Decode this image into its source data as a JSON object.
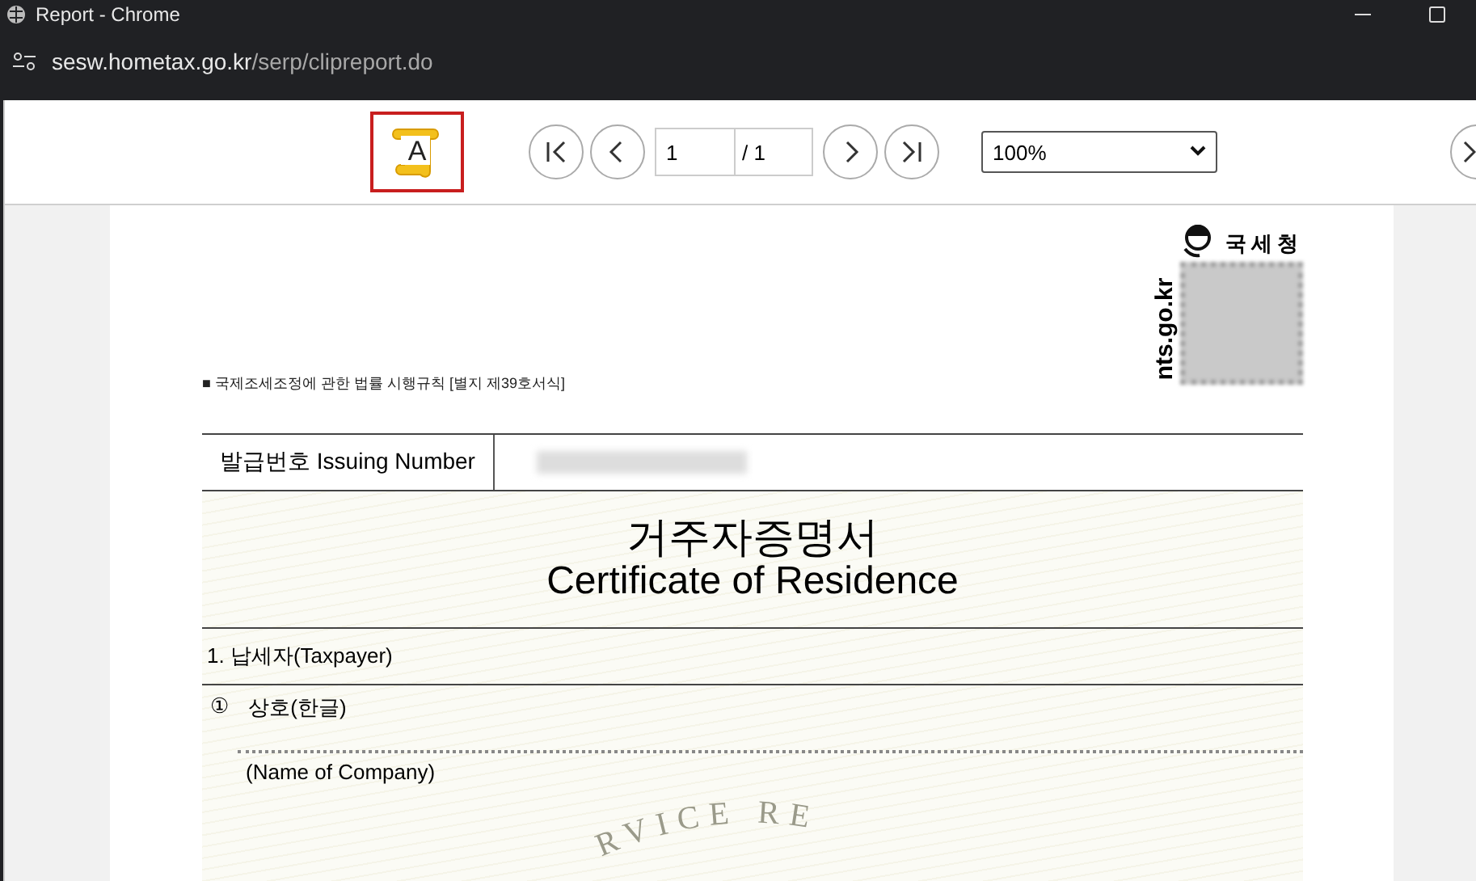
{
  "window": {
    "title": "Report - Chrome",
    "url_host": "sesw.hometax.go.kr",
    "url_path": "/serp/clipreport.do"
  },
  "toolbar": {
    "logo_letter": "A",
    "page_input": "1",
    "page_total": "/ 1",
    "zoom": "100%"
  },
  "document": {
    "logo": {
      "agency": "국세청",
      "site": "nts.go.kr"
    },
    "form_ref": "■ 국제조세조정에 관한 법률 시행규칙 [별지 제39호서식]",
    "issuing_label": "발급번호 Issuing Number",
    "title_ko": "거주자증명서",
    "title_en": "Certificate of Residence",
    "section": "1. 납세자(Taxpayer)",
    "field_mark": "①",
    "field_label": "상호(한글)",
    "field_label_en": "(Name of Company)",
    "seal_text": "RVICE RE"
  }
}
